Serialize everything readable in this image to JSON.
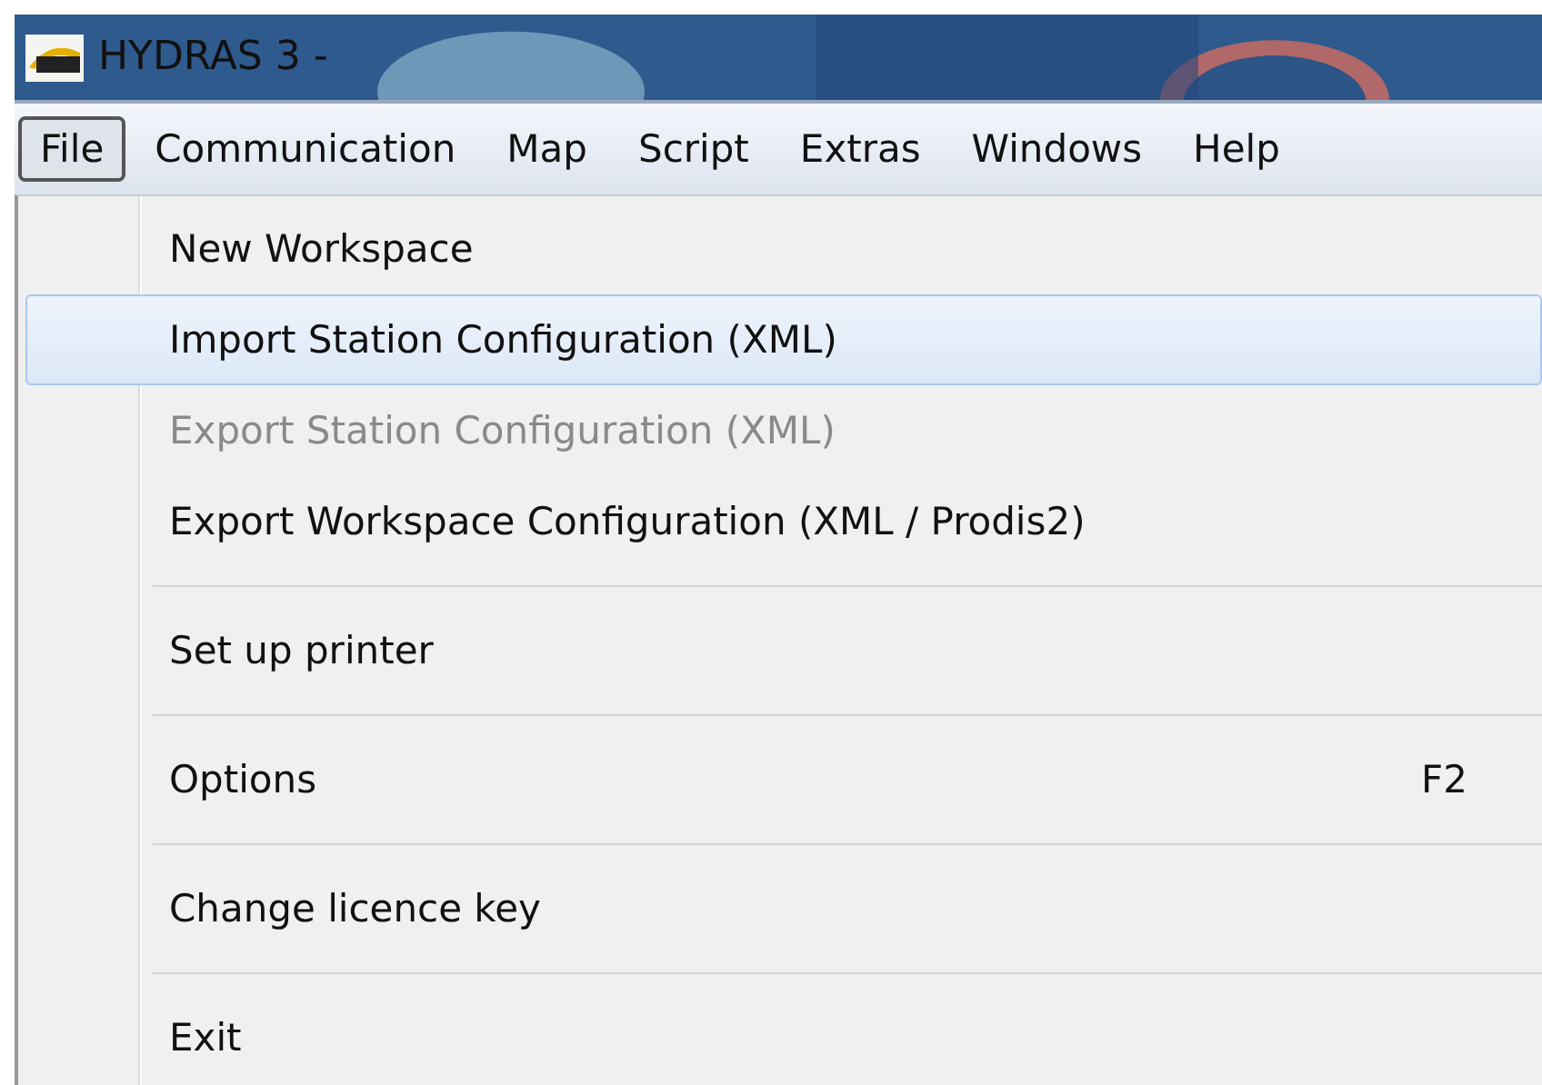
{
  "window": {
    "title": "HYDRAS 3 -"
  },
  "menu_bar": [
    {
      "label": "File",
      "selected": true
    },
    {
      "label": "Communication",
      "selected": false
    },
    {
      "label": "Map",
      "selected": false
    },
    {
      "label": "Script",
      "selected": false
    },
    {
      "label": "Extras",
      "selected": false
    },
    {
      "label": "Windows",
      "selected": false
    },
    {
      "label": "Help",
      "selected": false
    }
  ],
  "file_menu": [
    {
      "kind": "item",
      "label": "New Workspace",
      "selected": false,
      "disabled": false
    },
    {
      "kind": "item",
      "label": "Import Station Configuration (XML)",
      "selected": true,
      "disabled": false
    },
    {
      "kind": "item",
      "label": "Export Station Configuration (XML)",
      "selected": false,
      "disabled": true
    },
    {
      "kind": "item",
      "label": "Export Workspace Configuration (XML / Prodis2)",
      "selected": false,
      "disabled": false
    },
    {
      "kind": "separator"
    },
    {
      "kind": "item",
      "label": "Set up printer",
      "selected": false,
      "disabled": false
    },
    {
      "kind": "separator"
    },
    {
      "kind": "item",
      "label": "Options",
      "shortcut": "F2",
      "selected": false,
      "disabled": false
    },
    {
      "kind": "separator"
    },
    {
      "kind": "item",
      "label": "Change licence key",
      "selected": false,
      "disabled": false
    },
    {
      "kind": "separator"
    },
    {
      "kind": "item",
      "label": "Exit",
      "selected": false,
      "disabled": false
    }
  ]
}
